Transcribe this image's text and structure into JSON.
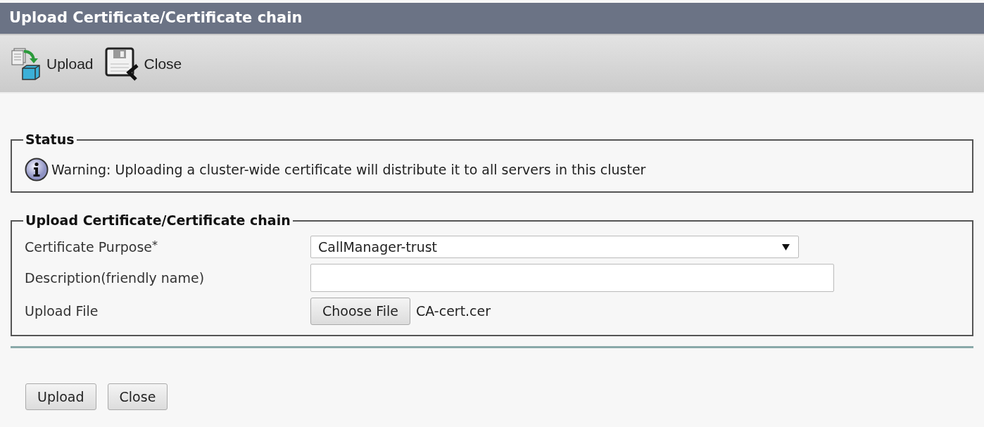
{
  "window": {
    "title": "Upload Certificate/Certificate chain"
  },
  "toolbar": [
    {
      "label": "Upload",
      "kind": "upload"
    },
    {
      "label": "Close",
      "kind": "close"
    }
  ],
  "status": {
    "legend": "Status",
    "message": "Warning: Uploading a cluster-wide certificate will distribute it to all servers in this cluster"
  },
  "form": {
    "legend": "Upload Certificate/Certificate chain",
    "fields": [
      {
        "label": "Certificate Purpose",
        "required_mark": "*",
        "kind": "select",
        "value": "CallManager-trust"
      },
      {
        "label": "Description(friendly name)",
        "kind": "text"
      },
      {
        "label": "Upload File",
        "kind": "file",
        "button": "Choose File",
        "value": "CA-cert.cer"
      }
    ]
  },
  "buttons": [
    "Upload",
    "Close"
  ]
}
